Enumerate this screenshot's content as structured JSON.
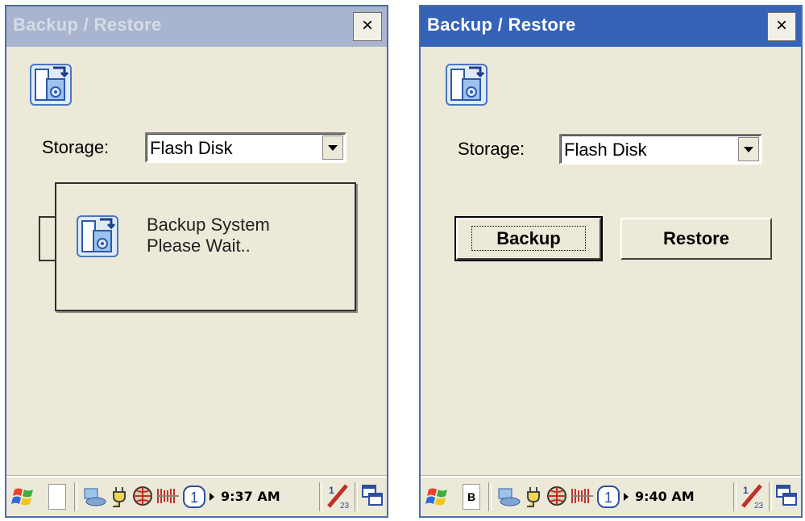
{
  "left_screen": {
    "title": "Backup / Restore",
    "close_label": "×",
    "storage_label": "Storage:",
    "storage_value": "Flash Disk",
    "dialog": {
      "line1": "Backup System",
      "line2": "Please Wait.."
    },
    "taskbar": {
      "time": "9:37 AM",
      "task_label": ""
    }
  },
  "right_screen": {
    "title": "Backup / Restore",
    "close_label": "×",
    "storage_label": "Storage:",
    "storage_value": "Flash Disk",
    "backup_button": "Backup",
    "restore_button": "Restore",
    "taskbar": {
      "time": "9:40 AM",
      "task_label": "B"
    }
  },
  "colors": {
    "active_title": "#3563b8",
    "inactive_title": "#a9b4cf",
    "window_bg": "#ece9d8"
  },
  "icons": [
    "backup-restore-app-icon",
    "windows-start-icon",
    "network-icon",
    "power-plug-icon",
    "globe-icon",
    "battery-icon",
    "keypad-mode-icon",
    "arrow-right-icon",
    "input-panel-icon",
    "switch-window-icon"
  ]
}
